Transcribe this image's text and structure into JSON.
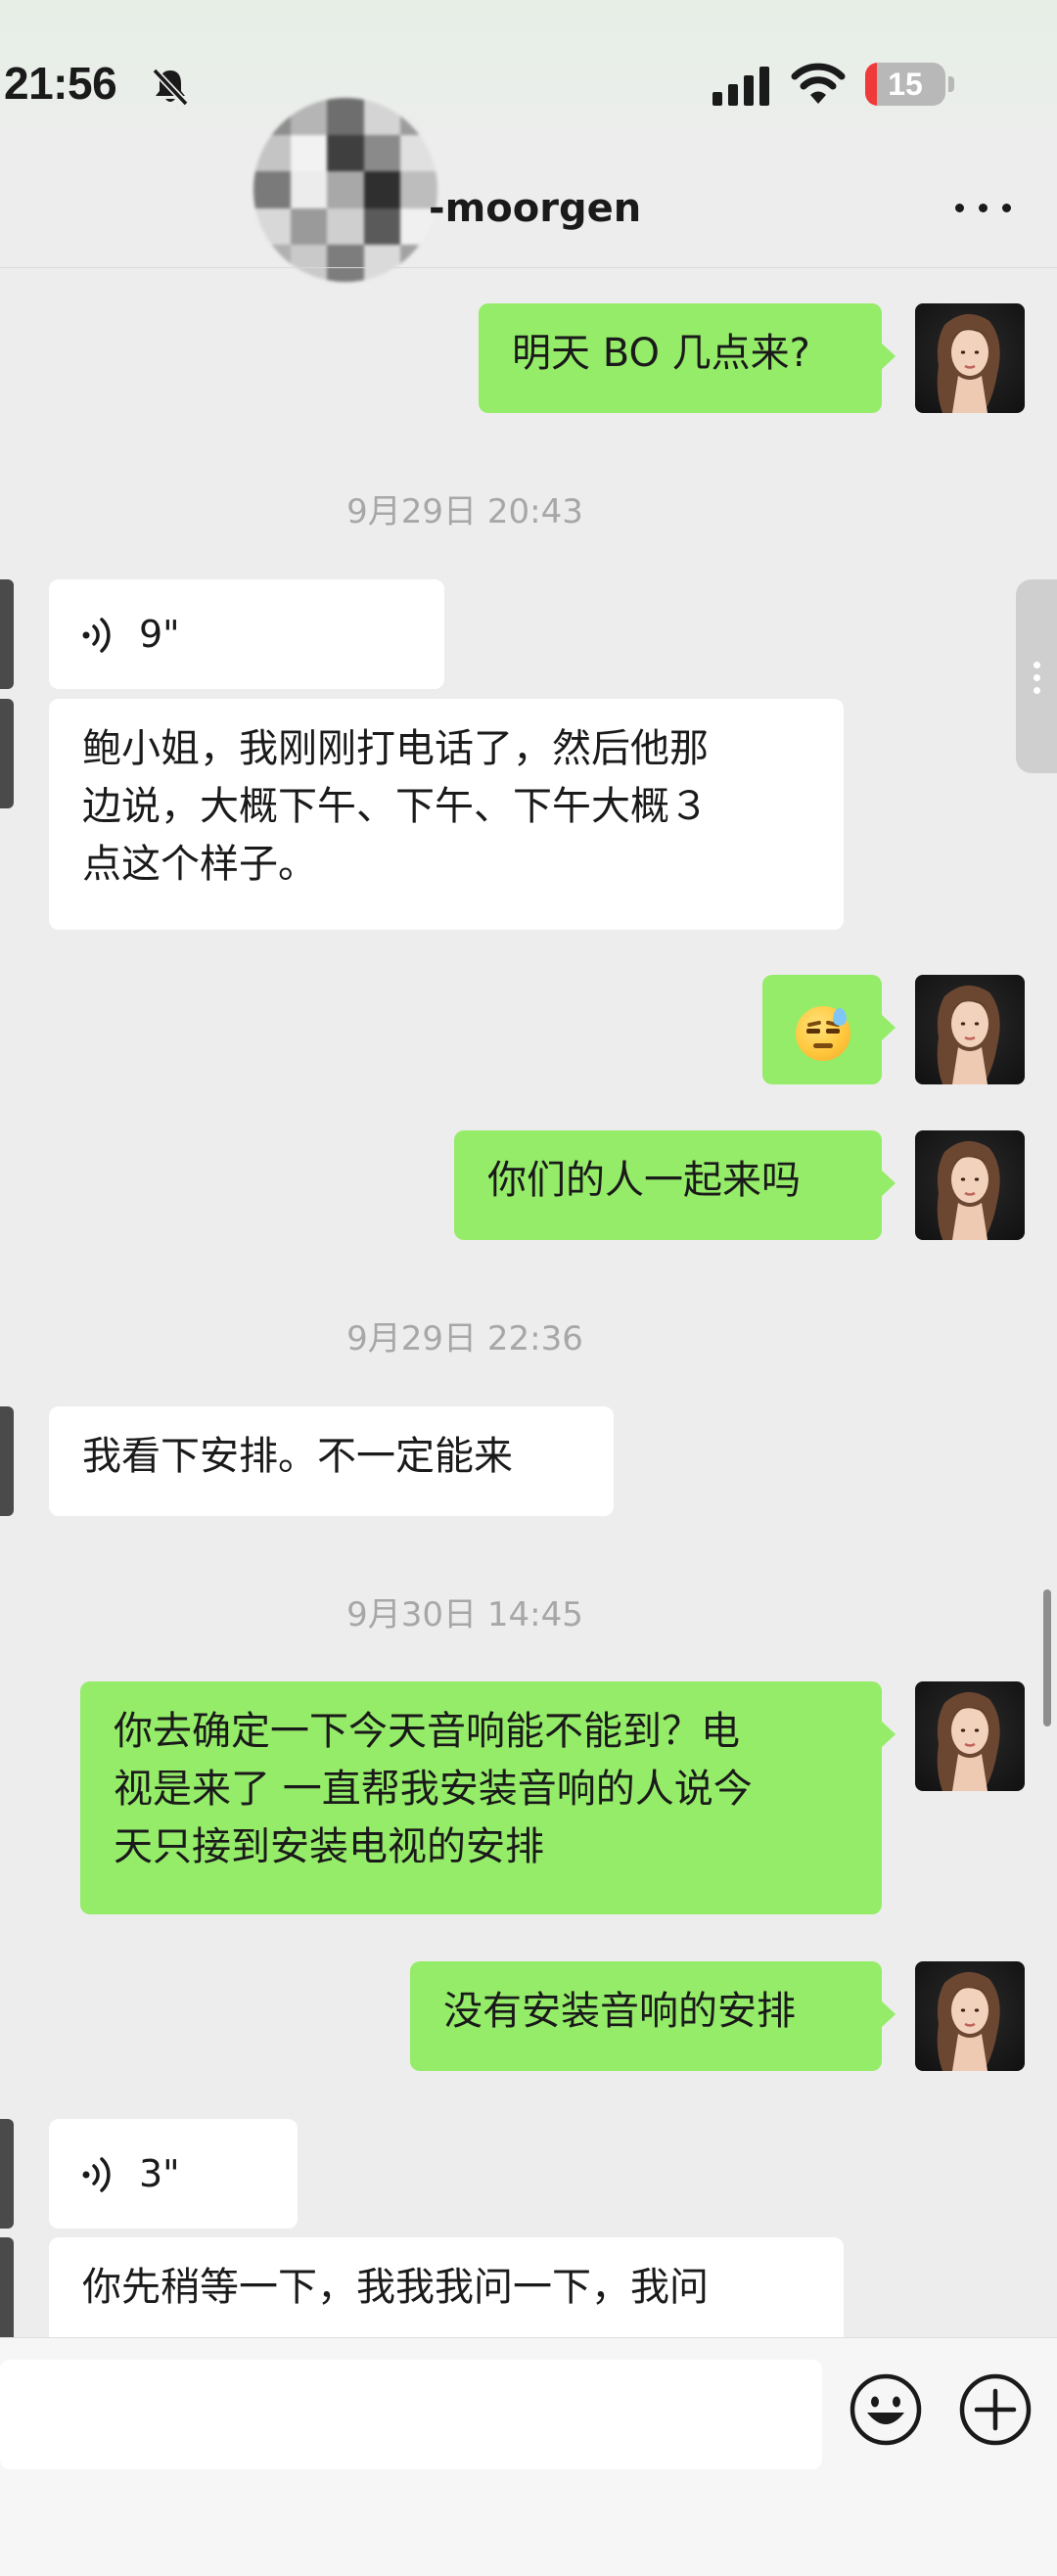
{
  "status_bar": {
    "time": "21:56",
    "battery_level": "15",
    "battery_fraction": 0.15,
    "icons": [
      "bell-muted-icon",
      "cellular-signal-icon",
      "wifi-icon",
      "battery-icon"
    ]
  },
  "header": {
    "contact_name": "-moorgen",
    "icons": [
      "blurred-avatar",
      "more-icon"
    ]
  },
  "messages": [
    {
      "type": "text",
      "direction": "outgoing",
      "lines": [
        "明天 BO 几点来?"
      ]
    },
    {
      "type": "timestamp",
      "text": "9月29日 20:43"
    },
    {
      "type": "voice",
      "direction": "incoming",
      "duration": "9\""
    },
    {
      "type": "text",
      "direction": "incoming",
      "lines": [
        "鲍小姐，我刚刚打电话了，然后他那",
        "边说，大概下午、下午、下午大概３",
        "点这个样子。"
      ]
    },
    {
      "type": "emoji",
      "direction": "outgoing",
      "emoji": "sweat-smile-emoji"
    },
    {
      "type": "text",
      "direction": "outgoing",
      "lines": [
        "你们的人一起来吗"
      ]
    },
    {
      "type": "timestamp",
      "text": "9月29日 22:36"
    },
    {
      "type": "text",
      "direction": "incoming",
      "lines": [
        "我看下安排。不一定能来"
      ]
    },
    {
      "type": "timestamp",
      "text": "9月30日 14:45"
    },
    {
      "type": "text",
      "direction": "outgoing",
      "lines": [
        "你去确定一下今天音响能不能到？电",
        "视是来了 一直帮我安装音响的人说今",
        "天只接到安装电视的安排"
      ]
    },
    {
      "type": "text",
      "direction": "outgoing",
      "lines": [
        "没有安装音响的安排"
      ]
    },
    {
      "type": "voice",
      "direction": "incoming",
      "duration": "3\""
    },
    {
      "type": "text",
      "direction": "incoming",
      "lines": [
        "你先稍等一下，我我我问一下，我问"
      ]
    }
  ],
  "input_bar": {
    "placeholder": "",
    "icons": [
      "emoji-icon",
      "plus-icon"
    ]
  },
  "colors": {
    "outgoing_bubble": "#95ec69",
    "incoming_bubble": "#ffffff",
    "background": "#ededed",
    "timestamp": "#a7a7a7",
    "battery_low": "#f03a3a"
  }
}
